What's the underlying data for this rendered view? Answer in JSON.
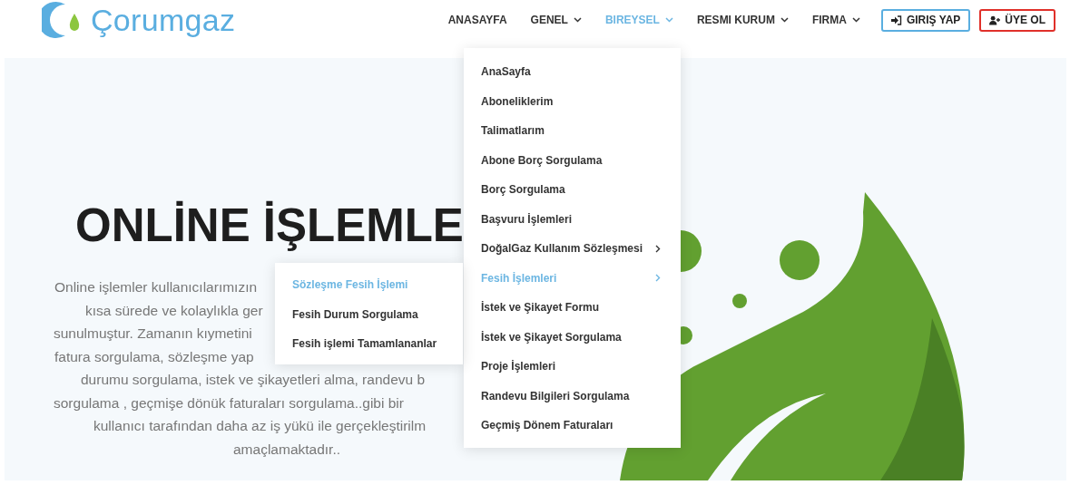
{
  "logo": {
    "text": "Çorumgaz"
  },
  "nav": [
    {
      "label": "ANASAYFA",
      "selected": false,
      "dropdown": false
    },
    {
      "label": "GENEL",
      "selected": false,
      "dropdown": true
    },
    {
      "label": "BIREYSEL",
      "selected": true,
      "dropdown": true
    },
    {
      "label": "RESMI KURUM",
      "selected": false,
      "dropdown": true
    },
    {
      "label": "FIRMA",
      "selected": false,
      "dropdown": true
    }
  ],
  "auth_buttons": [
    {
      "label": "GIRIŞ YAP",
      "kind": "login"
    },
    {
      "label": "ÜYE OL",
      "kind": "register"
    }
  ],
  "hero": {
    "heading": "ONLİNE İŞLEMLE",
    "paragraph_lines": [
      "Online işlemler kullanıcılarımızın",
      "kısa sürede ve kolaylıkla ger",
      "sunulmuştur. Zamanın kıymetini",
      "fatura sorgulama, sözleşme yap",
      "durumu sorgulama, istek ve şikayetleri alma, randevu b",
      "sorgulama , geçmişe dönük faturaları sorgulama..gibi bir",
      "kullanıcı tarafından daha az iş yükü ile gerçekleştirilm",
      "amaçlamaktadır.."
    ]
  },
  "dropdown": {
    "items": [
      {
        "label": "AnaSayfa",
        "selected": false,
        "has_submenu": false
      },
      {
        "label": "Aboneliklerim",
        "selected": false,
        "has_submenu": false
      },
      {
        "label": "Talimatlarım",
        "selected": false,
        "has_submenu": false
      },
      {
        "label": "Abone Borç Sorgulama",
        "selected": false,
        "has_submenu": false
      },
      {
        "label": "Borç Sorgulama",
        "selected": false,
        "has_submenu": false
      },
      {
        "label": "Başvuru İşlemleri",
        "selected": false,
        "has_submenu": false
      },
      {
        "label": "DoğalGaz Kullanım Sözleşmesi",
        "selected": false,
        "has_submenu": true
      },
      {
        "label": "Fesih İşlemleri",
        "selected": true,
        "has_submenu": true
      },
      {
        "label": "İstek ve Şikayet Formu",
        "selected": false,
        "has_submenu": false
      },
      {
        "label": "İstek ve Şikayet Sorgulama",
        "selected": false,
        "has_submenu": false
      },
      {
        "label": "Proje İşlemleri",
        "selected": false,
        "has_submenu": false
      },
      {
        "label": "Randevu Bilgileri Sorgulama",
        "selected": false,
        "has_submenu": false
      },
      {
        "label": "Geçmiş Dönem Faturaları",
        "selected": false,
        "has_submenu": false
      }
    ]
  },
  "submenu": {
    "items": [
      {
        "label": "Sözleşme Fesih İşlemi",
        "selected": true
      },
      {
        "label": "Fesih Durum Sorgulama",
        "selected": false
      },
      {
        "label": "Fesih işlemi Tamamlananlar",
        "selected": false
      }
    ]
  }
}
